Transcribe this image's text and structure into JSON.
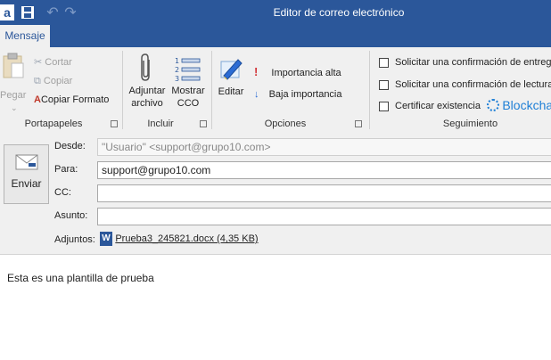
{
  "window": {
    "title": "Editor de correo electrónico",
    "app_icon_letter": "a"
  },
  "tabs": [
    {
      "label": "Mensaje",
      "active": true
    }
  ],
  "ribbon": {
    "portapapeles": {
      "paste_label": "Pegar",
      "cut_label": "Cortar",
      "copy_label": "Copiar",
      "format_painter_label": "Copiar Formato",
      "group_label": "Portapapeles"
    },
    "incluir": {
      "attach_label_1": "Adjuntar",
      "attach_label_2": "archivo",
      "show_bcc_label_1": "Mostrar",
      "show_bcc_label_2": "CCO",
      "group_label": "Incluir"
    },
    "opciones": {
      "edit_label": "Editar",
      "high_importance_label": "Importancia alta",
      "low_importance_label": "Baja importancia",
      "group_label": "Opciones"
    },
    "seguimiento": {
      "delivery_receipt_label": "Solicitar una confirmación de entrega",
      "read_receipt_label": "Solicitar una confirmación de lectura",
      "certify_label": "Certificar existencia",
      "blockchain_label": "Blockchain",
      "group_label": "Seguimiento"
    }
  },
  "form": {
    "send_label": "Enviar",
    "from_label": "Desde:",
    "from_value": "\"Usuario\" <support@grupo10.com>",
    "to_label": "Para:",
    "to_value": "support@grupo10.com",
    "cc_label": "CC:",
    "cc_value": "",
    "subject_label": "Asunto:",
    "subject_value": "",
    "attachments_label": "Adjuntos:",
    "attachment_name": "Prueba3_245821.docx (4,35 KB)"
  },
  "body": {
    "text": "Esta es una plantilla de prueba"
  },
  "colors": {
    "accent": "#2b579a",
    "ribbon_bg": "#f0f0f0",
    "importance_high": "#d13438",
    "importance_low": "#2b6cd4"
  }
}
